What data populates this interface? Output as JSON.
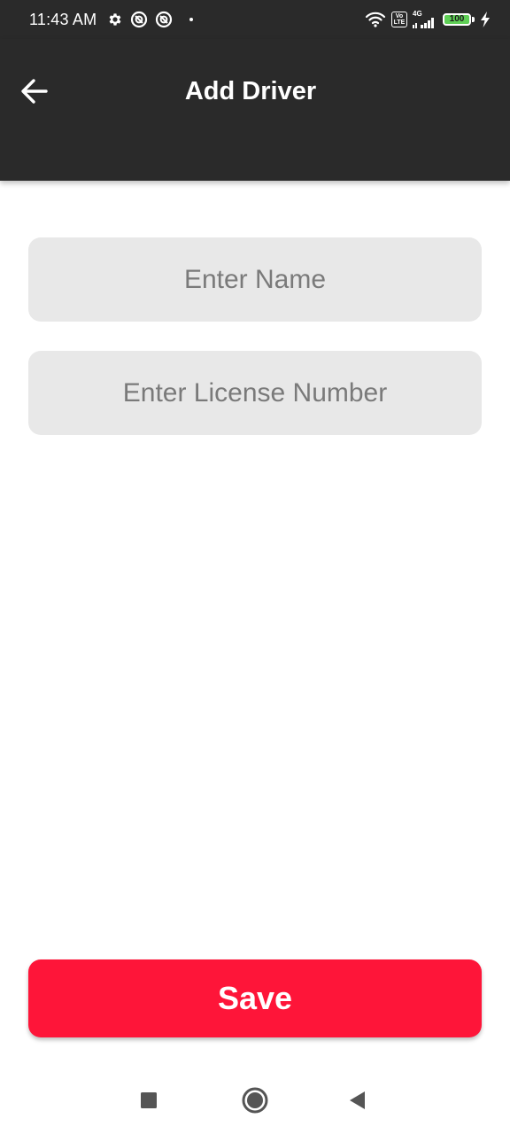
{
  "status_bar": {
    "time": "11:43 AM",
    "network_label": "4G",
    "volte_top": "Vo",
    "volte_bottom": "LTE",
    "battery_level": "100",
    "icons": [
      "settings-gear-icon",
      "notification-app-icon",
      "notification-app-icon",
      "dot-icon",
      "wifi-icon",
      "volte-icon",
      "signal-icon",
      "battery-icon",
      "charging-bolt-icon"
    ]
  },
  "app_bar": {
    "title": "Add Driver",
    "back_icon": "arrow-left-icon",
    "background": "#2a2a2a"
  },
  "form": {
    "name_placeholder": "Enter Name",
    "name_value": "",
    "license_placeholder": "Enter License Number",
    "license_value": "",
    "field_background": "#e8e8e8"
  },
  "save_button": {
    "label": "Save",
    "color": "#fe1539"
  },
  "nav_bar": {
    "icons": [
      "recents-square-icon",
      "home-circle-icon",
      "back-triangle-icon"
    ]
  }
}
